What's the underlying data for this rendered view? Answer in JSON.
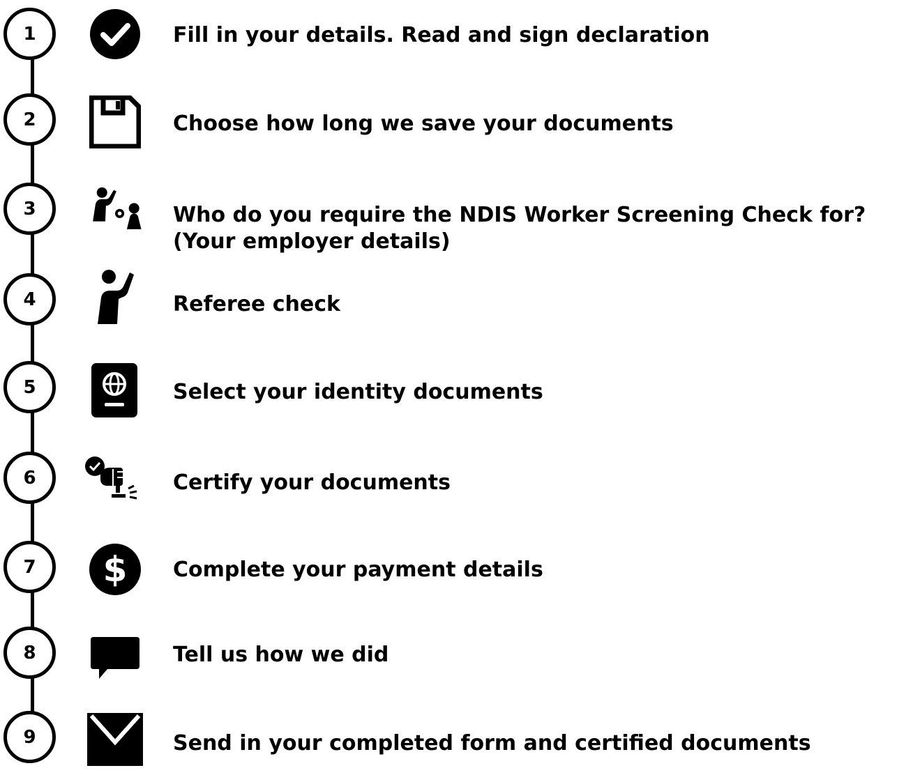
{
  "steps": [
    {
      "number": "1",
      "icon": "check-circle-icon",
      "text": "Fill in your details. Read and sign declaration"
    },
    {
      "number": "2",
      "icon": "floppy-disk-icon",
      "text": "Choose how long we save your documents"
    },
    {
      "number": "3",
      "icon": "worker-and-person-icon",
      "text": "Who do you require the NDIS Worker Screening Check for?",
      "text2": "(Your employer details)"
    },
    {
      "number": "4",
      "icon": "person-waving-icon",
      "text": "Referee check"
    },
    {
      "number": "5",
      "icon": "passport-icon",
      "text": "Select your identity documents"
    },
    {
      "number": "6",
      "icon": "stamp-certify-icon",
      "text": "Certify your documents"
    },
    {
      "number": "7",
      "icon": "dollar-circle-icon",
      "text": "Complete your payment details"
    },
    {
      "number": "8",
      "icon": "speech-bubble-icon",
      "text": "Tell us how we did"
    },
    {
      "number": "9",
      "icon": "envelope-icon",
      "text": "Send in your completed form and certified documents"
    }
  ]
}
